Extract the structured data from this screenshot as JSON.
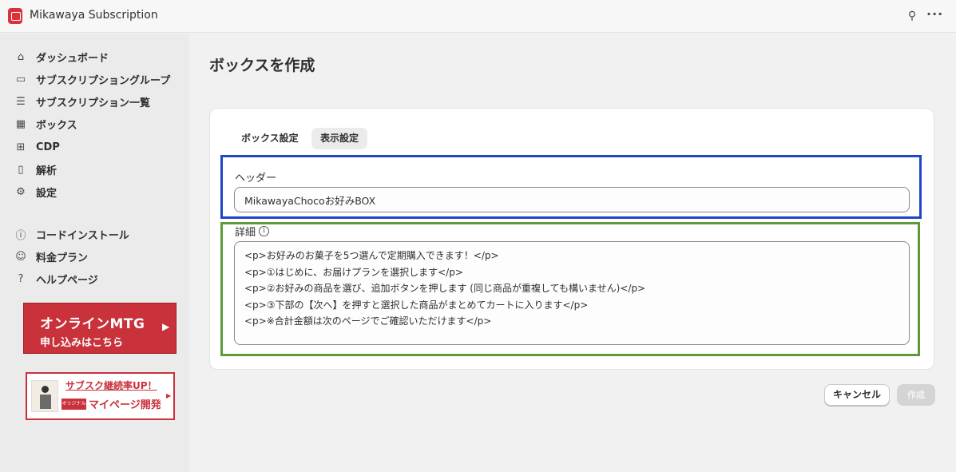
{
  "app": {
    "title": "Mikawaya Subscription"
  },
  "topbar": {
    "pin_icon": "pin-icon",
    "more_icon": "ellipsis-icon"
  },
  "sidebar": {
    "items": [
      {
        "label": "ダッシュボード",
        "icon": "home-icon"
      },
      {
        "label": "サブスクリプショングループ",
        "icon": "folder-icon"
      },
      {
        "label": "サブスクリプション一覧",
        "icon": "list-icon"
      },
      {
        "label": "ボックス",
        "icon": "box-icon"
      },
      {
        "label": "CDP",
        "icon": "grid-icon"
      },
      {
        "label": "解析",
        "icon": "bar-chart-icon"
      },
      {
        "label": "設定",
        "icon": "gear-icon"
      }
    ],
    "secondary_items": [
      {
        "label": "コードインストール",
        "icon": "info-icon"
      },
      {
        "label": "料金プラン",
        "icon": "user-circle-icon"
      },
      {
        "label": "ヘルプページ",
        "icon": "help-icon"
      }
    ],
    "banner_mtg": {
      "line1": "オンラインMTG",
      "line2": "申し込みはこちら"
    },
    "banner_mypage": {
      "line1": "サブスク継続率UP！",
      "tag": "オリジナル",
      "line2": "マイページ開発"
    }
  },
  "page": {
    "title": "ボックスを作成"
  },
  "tabs": [
    {
      "label": "ボックス設定",
      "selected": false
    },
    {
      "label": "表示設定",
      "selected": true
    }
  ],
  "form": {
    "header_label": "ヘッダー",
    "header_value": "MikawayaChocoお好みBOX",
    "detail_label": "詳細",
    "detail_lines": [
      "<p>お好みのお菓子を5つ選んで定期購入できます！</p>",
      "<p>①はじめに、お届けプランを選択します</p>",
      "<p>②お好みの商品を選び、追加ボタンを押します (同じ商品が重複しても構いません)</p>",
      "<p>③下部の【次へ】を押すと選択した商品がまとめてカートに入ります</p>",
      "<p>※合計金額は次のページでご確認いただけます</p>"
    ]
  },
  "actions": {
    "cancel_label": "キャンセル",
    "create_label": "作成"
  },
  "colors": {
    "highlight_header": "#1e46c7",
    "highlight_detail": "#5e9a38",
    "brand_red": "#c9313b"
  }
}
